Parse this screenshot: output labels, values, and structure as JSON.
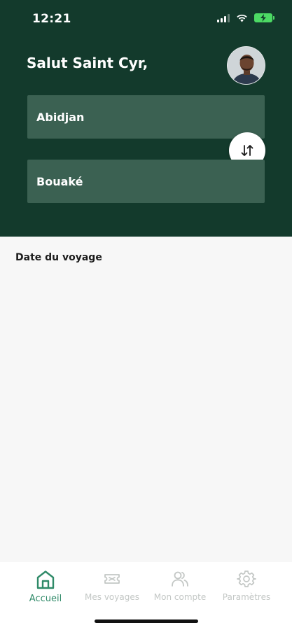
{
  "status_bar": {
    "time": "12:21"
  },
  "header": {
    "greeting": "Salut Saint Cyr,"
  },
  "route": {
    "from": "Abidjan",
    "to": "Bouaké",
    "swap_icon": "swap-vertical-arrows-icon"
  },
  "trip": {
    "date_label": "Date du voyage"
  },
  "bottom_nav": {
    "items": [
      {
        "label": "Accueil",
        "icon": "home-icon",
        "active": true
      },
      {
        "label": "Mes voyages",
        "icon": "ticket-icon",
        "active": false
      },
      {
        "label": "Mon compte",
        "icon": "users-icon",
        "active": false
      },
      {
        "label": "Paramètres",
        "icon": "gear-icon",
        "active": false
      }
    ]
  },
  "colors": {
    "header_bg": "#133a2c",
    "field_bg": "#3b6152",
    "active_nav": "#2f8a68",
    "inactive_nav": "#c3c7c5",
    "battery": "#4cd964"
  }
}
